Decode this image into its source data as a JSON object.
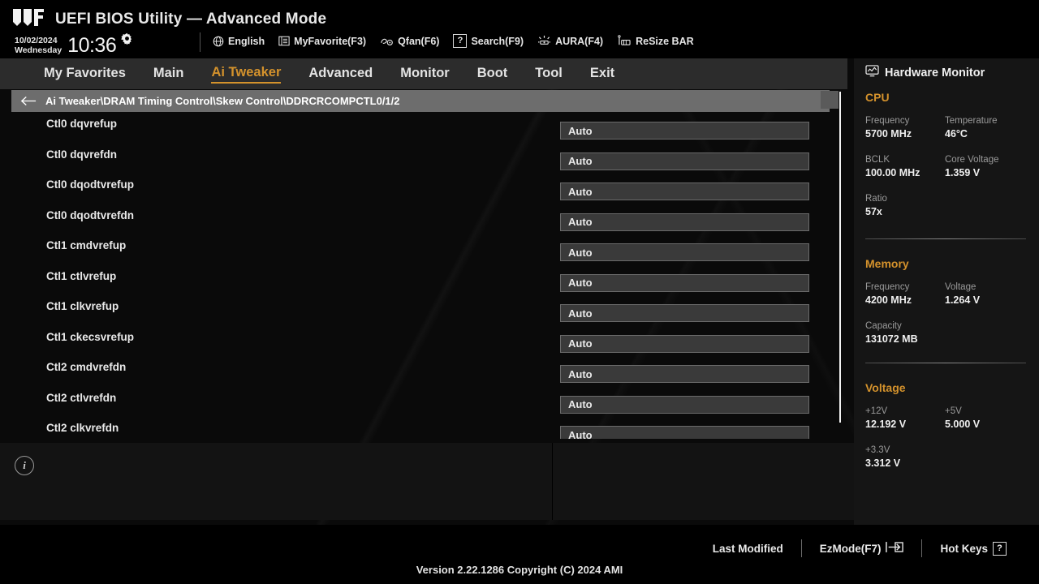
{
  "header": {
    "logo_icon": "tuf-gaming-logo",
    "title": "UEFI BIOS Utility — Advanced Mode",
    "date": "10/02/2024",
    "weekday": "Wednesday",
    "time": "10:36",
    "gear_icon": "gear-icon",
    "tools": [
      {
        "label": "English",
        "icon": "globe-icon"
      },
      {
        "label": "MyFavorite(F3)",
        "icon": "list-icon"
      },
      {
        "label": "Qfan(F6)",
        "icon": "fan-icon"
      },
      {
        "label": "Search(F9)",
        "icon": "question-box-icon"
      },
      {
        "label": "AURA(F4)",
        "icon": "aura-light-icon"
      },
      {
        "label": "ReSize BAR",
        "icon": "resize-bar-icon"
      }
    ]
  },
  "menu": {
    "items": [
      {
        "label": "My Favorites",
        "active": false
      },
      {
        "label": "Main",
        "active": false
      },
      {
        "label": "Ai Tweaker",
        "active": true
      },
      {
        "label": "Advanced",
        "active": false
      },
      {
        "label": "Monitor",
        "active": false
      },
      {
        "label": "Boot",
        "active": false
      },
      {
        "label": "Tool",
        "active": false
      },
      {
        "label": "Exit",
        "active": false
      }
    ],
    "accent_color": "#d4922c"
  },
  "breadcrumb": {
    "back_icon": "arrow-left-icon",
    "path": "Ai Tweaker\\DRAM Timing Control\\Skew Control\\DDRCRCOMPCTL0/1/2"
  },
  "settings": {
    "rows": [
      {
        "label": "Ctl0 dqvrefup",
        "value": "Auto"
      },
      {
        "label": "Ctl0 dqvrefdn",
        "value": "Auto"
      },
      {
        "label": "Ctl0 dqodtvrefup",
        "value": "Auto"
      },
      {
        "label": "Ctl0 dqodtvrefdn",
        "value": "Auto"
      },
      {
        "label": "Ctl1 cmdvrefup",
        "value": "Auto"
      },
      {
        "label": "Ctl1 ctlvrefup",
        "value": "Auto"
      },
      {
        "label": "Ctl1 clkvrefup",
        "value": "Auto"
      },
      {
        "label": "Ctl1 ckecsvrefup",
        "value": "Auto"
      },
      {
        "label": "Ctl2 cmdvrefdn",
        "value": "Auto"
      },
      {
        "label": "Ctl2 ctlvrefdn",
        "value": "Auto"
      },
      {
        "label": "Ctl2 clkvrefdn",
        "value": "Auto"
      }
    ]
  },
  "info_panel": {
    "icon": "info-icon",
    "text": ""
  },
  "hardware_monitor": {
    "title": "Hardware Monitor",
    "title_icon": "monitor-icon",
    "sections": [
      {
        "name": "CPU",
        "items": [
          {
            "key": "Frequency",
            "value": "5700 MHz"
          },
          {
            "key": "Temperature",
            "value": "46°C"
          },
          {
            "key": "BCLK",
            "value": "100.00 MHz"
          },
          {
            "key": "Core Voltage",
            "value": "1.359 V"
          },
          {
            "key": "Ratio",
            "value": "57x"
          }
        ]
      },
      {
        "name": "Memory",
        "items": [
          {
            "key": "Frequency",
            "value": "4200 MHz"
          },
          {
            "key": "Voltage",
            "value": "1.264 V"
          },
          {
            "key": "Capacity",
            "value": "131072 MB"
          }
        ]
      },
      {
        "name": "Voltage",
        "items": [
          {
            "key": "+12V",
            "value": "12.192 V"
          },
          {
            "key": "+5V",
            "value": "5.000 V"
          },
          {
            "key": "+3.3V",
            "value": "3.312 V"
          }
        ]
      }
    ]
  },
  "footer": {
    "last_modified": "Last Modified",
    "ezmode": "EzMode(F7)",
    "ezmode_icon": "arrow-into-box-icon",
    "hotkeys": "Hot Keys",
    "hotkeys_icon": "question-box-icon",
    "version": "Version 2.22.1286 Copyright (C) 2024 AMI"
  }
}
